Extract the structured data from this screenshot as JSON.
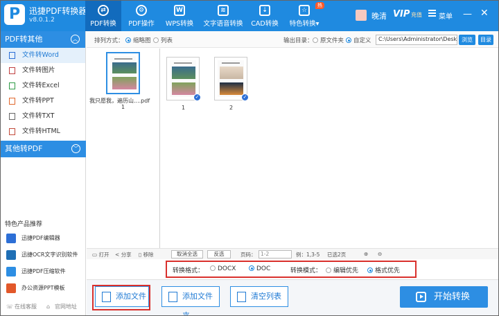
{
  "app": {
    "title": "迅捷PDF转换器",
    "version": "v8.0.1.2",
    "logo_letter": "P"
  },
  "nav": [
    {
      "label": "PDF转换",
      "icon": "transfer-icon"
    },
    {
      "label": "PDF操作",
      "icon": "gear-icon"
    },
    {
      "label": "WPS转换",
      "icon": "wps-icon"
    },
    {
      "label": "文字语音转换",
      "icon": "waveform-icon"
    },
    {
      "label": "CAD转换",
      "icon": "cad-icon"
    },
    {
      "label": "特色转换",
      "icon": "gift-icon",
      "badge": "热"
    }
  ],
  "user": {
    "name": "晚清",
    "vip": "VIP",
    "vip_sub": "充值",
    "menu": "菜单"
  },
  "window": {
    "minimize": "—",
    "close": "✕"
  },
  "sidebar": {
    "group1": "PDF转其他",
    "items": [
      {
        "label": "文件转Word",
        "icon": "word-file-icon"
      },
      {
        "label": "文件转图片",
        "icon": "image-file-icon"
      },
      {
        "label": "文件转Excel",
        "icon": "excel-file-icon"
      },
      {
        "label": "文件转PPT",
        "icon": "ppt-file-icon"
      },
      {
        "label": "文件转TXT",
        "icon": "txt-file-icon"
      },
      {
        "label": "文件转HTML",
        "icon": "html-file-icon"
      }
    ],
    "group2": "其他转PDF",
    "rec_title": "特色产品推荐",
    "recommend": [
      {
        "label": "迅捷PDF编辑器",
        "icon": "pdf-editor-icon",
        "color": "#2d6fd6"
      },
      {
        "label": "迅捷OCR文字识别软件",
        "icon": "ocr-icon",
        "color": "#1f6fb5"
      },
      {
        "label": "迅捷PDF压缩软件",
        "icon": "compress-icon",
        "color": "#2d8ee3"
      },
      {
        "label": "办公资源PPT模板",
        "icon": "ppt-template-icon",
        "color": "#e2582a"
      }
    ],
    "footer_service": "在线客服",
    "footer_site": "官网地址"
  },
  "options": {
    "sort_label": "排列方式：",
    "view_thumb": "缩略图",
    "view_list": "列表",
    "output_label": "输出目录：",
    "output_source": "原文件夹",
    "output_custom": "自定义",
    "output_path": "C:\\Users\\Administrator\\Desktop",
    "browse": "浏览",
    "dir": "目录"
  },
  "file": {
    "name": "我只愿我，遍历山....pdf",
    "count": "1"
  },
  "pages": [
    {
      "label": "1",
      "checked": true
    },
    {
      "label": "2",
      "checked": true
    }
  ],
  "strip": {
    "open": "打开",
    "share": "分享",
    "remove": "移除",
    "deselect_all": "取消全选",
    "invert": "反选",
    "page_label": "页码：",
    "page_placeholder": "1-2",
    "example": "例：1,3-5",
    "selected": "已选2页"
  },
  "format": {
    "label": "转换格式：",
    "docx": "DOCX",
    "doc": "DOC",
    "mode_label": "转换模式：",
    "edit_first": "编辑优先",
    "format_first": "格式优先"
  },
  "actions": {
    "add_file": "添加文件",
    "add_folder": "添加文件夹",
    "clear": "清空列表",
    "start": "开始转换"
  },
  "colors": {
    "primary": "#1f8ae0",
    "highlight": "#d9302c"
  }
}
